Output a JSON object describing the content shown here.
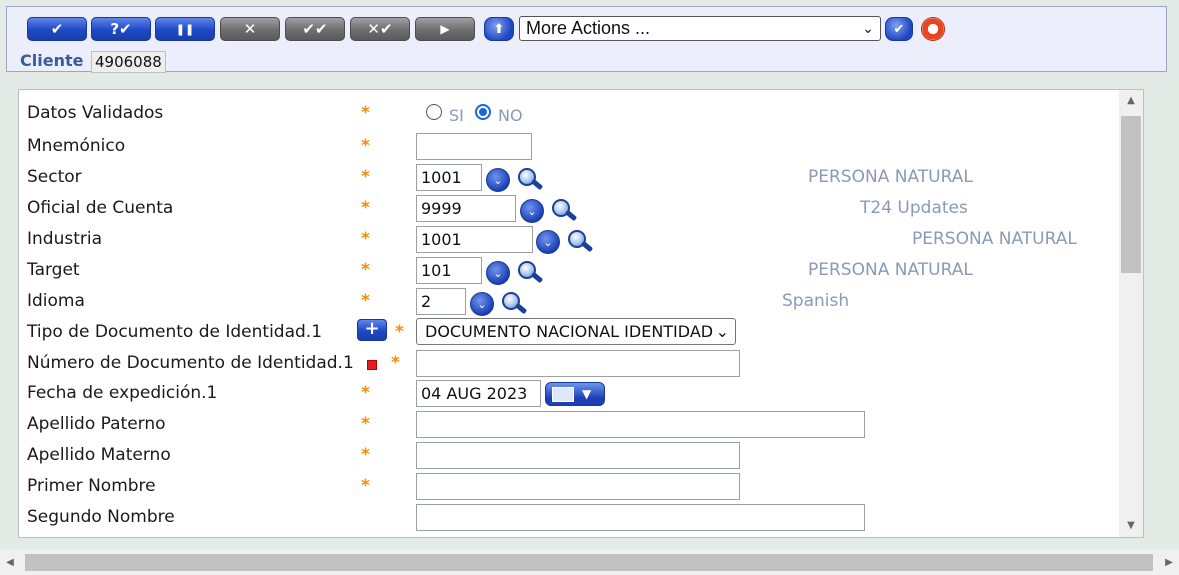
{
  "toolbar": {
    "buttons": [
      {
        "name": "validate",
        "glyph": "✔"
      },
      {
        "name": "hold",
        "glyph": "?✔"
      },
      {
        "name": "pause",
        "glyph": "❚❚"
      },
      {
        "name": "delete",
        "glyph": "✕"
      },
      {
        "name": "authorise",
        "glyph": "✔✔"
      },
      {
        "name": "reject",
        "glyph": "✕✔"
      },
      {
        "name": "next",
        "glyph": "▶"
      }
    ],
    "up_glyph": "⬆",
    "go_glyph": "✔",
    "more_actions": "More Actions ...",
    "help_icon": "lifebuoy-icon"
  },
  "record": {
    "label": "Cliente",
    "value": "4906088"
  },
  "form": {
    "datos_validados": {
      "label": "Datos Validados",
      "opt_si": "SI",
      "opt_no": "NO",
      "selected": "NO"
    },
    "mnemonico": {
      "label": "Mnemónico",
      "value": ""
    },
    "sector": {
      "label": "Sector",
      "value": "1001",
      "enrichment": "PERSONA NATURAL"
    },
    "oficial": {
      "label": "Oficial de Cuenta",
      "value": "9999",
      "enrichment": "T24 Updates"
    },
    "industria": {
      "label": "Industria",
      "value": "1001",
      "enrichment": "PERSONA NATURAL"
    },
    "target": {
      "label": "Target",
      "value": "101",
      "enrichment": "PERSONA NATURAL"
    },
    "idioma": {
      "label": "Idioma",
      "value": "2",
      "enrichment": "Spanish"
    },
    "tipo_doc": {
      "label": "Tipo de Documento de Identidad.1",
      "value": "DOCUMENTO NACIONAL IDENTIDAD"
    },
    "num_doc": {
      "label": "Número de Documento de Identidad.1",
      "value": ""
    },
    "fecha_exp": {
      "label": "Fecha de expedición.1",
      "value": "04 AUG 2023"
    },
    "apellido_paterno": {
      "label": "Apellido Paterno",
      "value": ""
    },
    "apellido_materno": {
      "label": "Apellido Materno",
      "value": ""
    },
    "primer_nombre": {
      "label": "Primer Nombre",
      "value": ""
    },
    "segundo_nombre": {
      "label": "Segundo Nombre",
      "value": ""
    }
  },
  "colors": {
    "mandatory": "#ff8800",
    "enrichment": "#8a9ab4",
    "label_blue": "#3b5a9a"
  }
}
